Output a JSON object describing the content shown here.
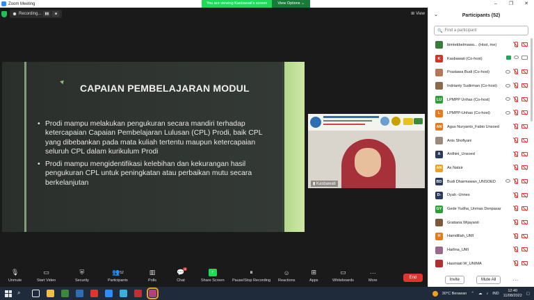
{
  "window": {
    "title": "Zoom Meeting"
  },
  "window_controls": {
    "minimize": "–",
    "maximize": "❐",
    "close": "✕"
  },
  "banner": {
    "viewing": "You are viewing Kasbawati's screen",
    "view_options": "View Options ⌄"
  },
  "recording": {
    "label": "Recording...",
    "pause": "▮▮",
    "stop": "■"
  },
  "view_button": "View",
  "slide": {
    "title": "CAPAIAN PEMBELAJARAN MODUL",
    "bullets": [
      "Prodi mampu melakukan pengukuran secara mandiri terhadap ketercapaian Capaian Pembelajaran Lulusan (CPL) Prodi, baik CPL yang dibebankan pada mata kuliah tertentu maupun ketercapaian seluruh CPL dalam kurikulum Prodi",
      "Prodi mampu mengidentifikasi kelebihan dan kekurangan hasil pengukuran CPL untuk peningkatan atau perbaikan mutu secara berkelanjutan"
    ]
  },
  "video": {
    "name": "Kasbawati"
  },
  "toolbar": {
    "unmute": "Unmute",
    "start_video": "Start Video",
    "security": "Security",
    "participants": "Participants",
    "participants_count": "52",
    "polls": "Polls",
    "chat": "Chat",
    "chat_badge": "4",
    "share_screen": "Share Screen",
    "recording": "Pause/Stop Recording",
    "reactions": "Reactions",
    "apps": "Apps",
    "whiteboards": "Whiteboards",
    "more": "More",
    "end": "End"
  },
  "participants_panel": {
    "title": "Participants (52)",
    "search_placeholder": "Find a participant",
    "invite": "Invite",
    "mute_all": "Mute All",
    "more": "···",
    "list": [
      {
        "initials": "",
        "name": "bimtekbelmawa... (Host, me)",
        "color": "#3a7a3a",
        "video": "off"
      },
      {
        "initials": "K",
        "name": "Kasbawati (Co-host)",
        "color": "#d0342c",
        "video": "on-green"
      },
      {
        "initials": "",
        "name": "Prastawa Budi (Co-host)",
        "color": "#b07a5a",
        "video": "eye"
      },
      {
        "initials": "",
        "name": "Indrianty Sudirman (Co-host)",
        "color": "#8a6a4a",
        "video": "eye"
      },
      {
        "initials": "LU",
        "name": "LPMPP Unhas (Co-host)",
        "color": "#2e9e3a",
        "video": "eye"
      },
      {
        "initials": "L",
        "name": "LPMPP-Unhas (Co-host)",
        "color": "#e87a1a",
        "video": "eye"
      },
      {
        "initials": "AN",
        "name": "Agus Nuryanto_Fabio Unsoed",
        "color": "#e87a1a",
        "video": "off"
      },
      {
        "initials": "",
        "name": "Anis Shofiyani",
        "color": "#9a8a7a",
        "video": "off"
      },
      {
        "initials": "A",
        "name": "Ardhini_Unsoed",
        "color": "#2a3a5a",
        "video": "off"
      },
      {
        "initials": "AN",
        "name": "As Natsir",
        "color": "#f0a020",
        "video": "off"
      },
      {
        "initials": "BD",
        "name": "Budi Dharmawan_UNSOED",
        "color": "#2a3a5a",
        "video": "eye"
      },
      {
        "initials": "D-",
        "name": "Dyah -Unnes",
        "color": "#2a3a5a",
        "video": "off"
      },
      {
        "initials": "GY",
        "name": "Gede Yudha_Unmas Denpasar",
        "color": "#2e9e3a",
        "video": "off"
      },
      {
        "initials": "",
        "name": "Gratiana Wijayanti",
        "color": "#7a5a3a",
        "video": "off"
      },
      {
        "initials": "H",
        "name": "Hamdillah_UMI",
        "color": "#e87a1a",
        "video": "off"
      },
      {
        "initials": "",
        "name": "Harlina_UMI",
        "color": "#9a6a8a",
        "video": "off"
      },
      {
        "initials": "",
        "name": "Hasmiati W_UNIMA",
        "color": "#b03030",
        "video": "off"
      }
    ]
  },
  "taskbar": {
    "weather": "30°C  Berawan",
    "lang": "IND",
    "time": "12:40",
    "date": "11/08/2022",
    "apps": [
      "#f0c040",
      "#3a8a3a",
      "#2e6fb3",
      "#e0352f",
      "#2d8cff",
      "#3ab0e0",
      "#c03030",
      "#b04080"
    ]
  },
  "colors": {
    "accent_green": "#23d959",
    "end_red": "#e0352f",
    "zoom_blue": "#2d8cff"
  }
}
